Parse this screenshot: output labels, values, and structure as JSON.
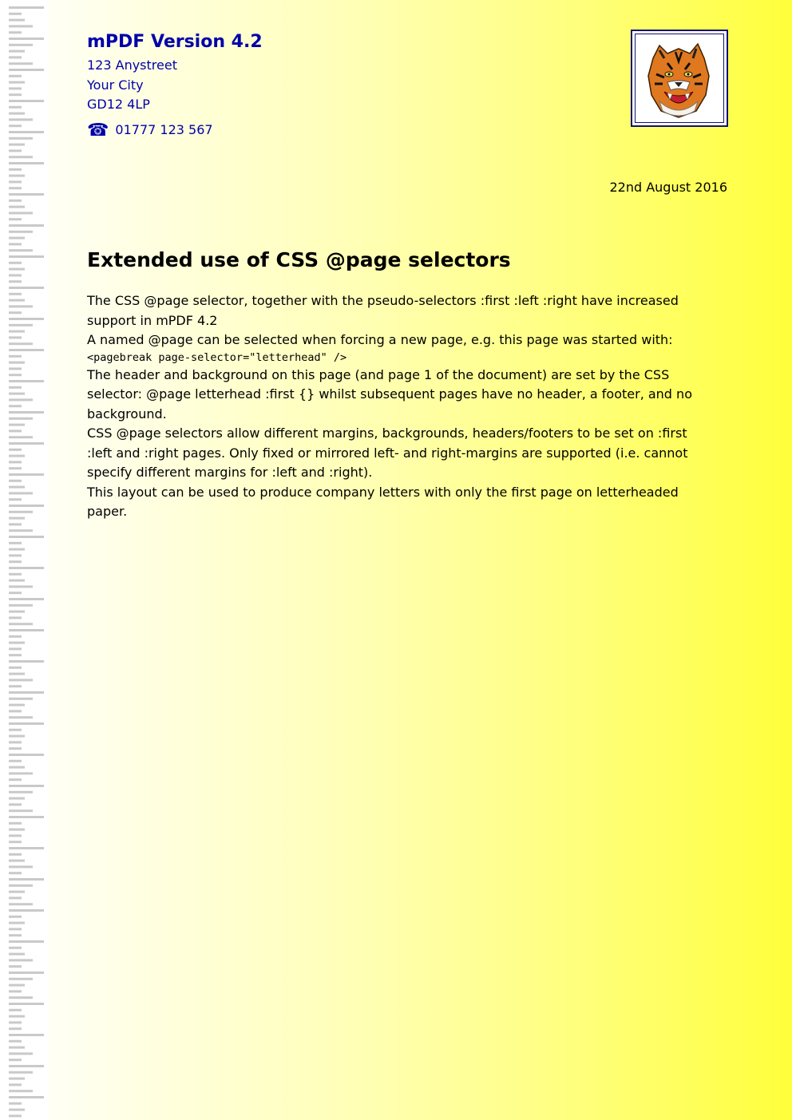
{
  "letterhead": {
    "company": "mPDF Version 4.2",
    "address": [
      "123 Anystreet",
      "Your City",
      "GD12 4LP"
    ],
    "phone_icon": "telephone-icon",
    "phone_glyph": "☎",
    "phone": "01777 123 567"
  },
  "logo": {
    "icon": "tiger-logo-icon"
  },
  "date": "22nd August 2016",
  "title": "Extended use of CSS @page selectors",
  "lines": [
    "The CSS @page selector, together with the pseudo-selectors :first :left :right have increased",
    "support in mPDF 4.2",
    "A named @page can be selected when forcing a new page, e.g. this page was started with:",
    "<pagebreak page-selector=\"letterhead\" />",
    "The header and background on this page (and page 1 of the document) are set by the CSS",
    "selector: @page letterhead :first {} whilst subsequent pages have no header, a footer, and no",
    "background.",
    "CSS @page selectors allow different margins, backgrounds, headers/footers to be set on :first",
    ":left and :right pages. Only fixed or mirrored left- and right-margins are supported (i.e. cannot",
    "specify different margins for :left and :right).",
    "This layout can be used to produce company letters with only the first page on letterheaded",
    "paper."
  ]
}
